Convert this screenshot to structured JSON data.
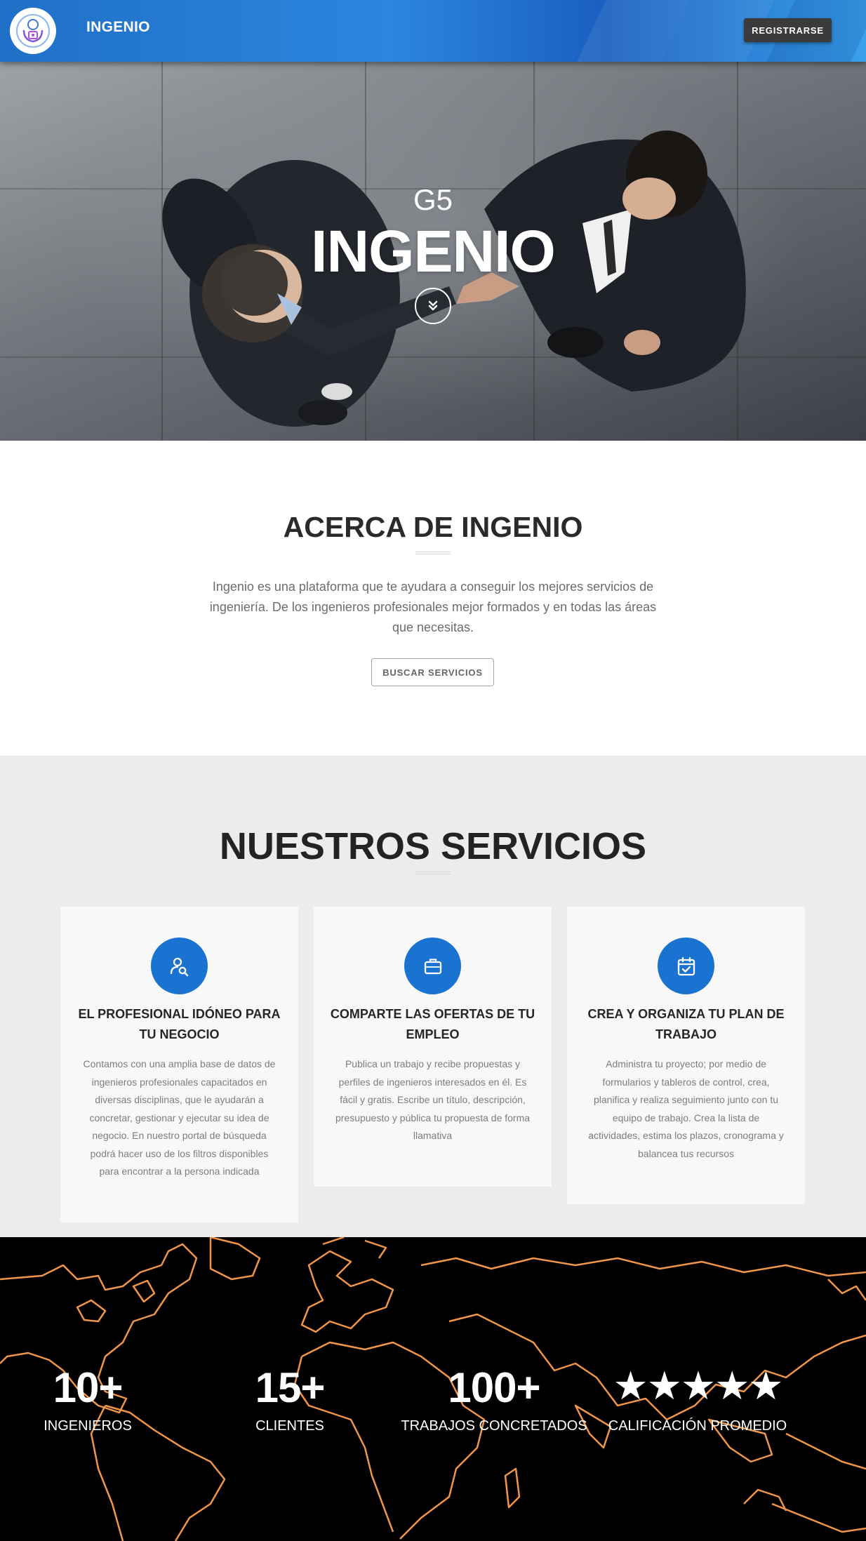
{
  "navbar": {
    "brand": "INGENIO",
    "logo_icon": "ingenio-logo-icon",
    "register_label": "REGISTRARSE"
  },
  "hero": {
    "subtitle": "G5",
    "title": "INGENIO",
    "scroll_icon": "chevron-double-down-icon"
  },
  "about": {
    "title": "ACERCA DE INGENIO",
    "text": "Ingenio es una plataforma que te ayudara a conseguir los mejores servicios de ingeniería. De los ingenieros profesionales mejor formados y en todas las áreas que necesitas.",
    "button_label": "BUSCAR SERVICIOS"
  },
  "services": {
    "title": "NUESTROS SERVICIOS",
    "cards": [
      {
        "icon": "user-search-icon",
        "title": "EL PROFESIONAL IDÓNEO PARA TU NEGOCIO",
        "text": "Contamos con una amplia base de datos de ingenieros profesionales capacitados en diversas disciplinas, que le ayudarán a concretar, gestionar y ejecutar su idea de negocio. En nuestro portal de búsqueda podrá hacer uso de los filtros disponibles para encontrar a la persona indicada"
      },
      {
        "icon": "briefcase-icon",
        "title": "COMPARTE LAS OFERTAS DE TU EMPLEO",
        "text": "Publica un trabajo y recibe propuestas y perfiles de ingenieros interesados en él. Es fácil y gratis. Escribe un título, descripción, presupuesto y pública tu propuesta de forma llamativa"
      },
      {
        "icon": "calendar-check-icon",
        "title": "CREA Y ORGANIZA TU PLAN DE TRABAJO",
        "text": "Administra tu proyecto; por medio de formularios y tableros de control, crea, planifica y realiza seguimiento junto con tu equipo de trabajo. Crea la lista de actividades, estima los plazos, cronograma y balancea tus recursos"
      }
    ]
  },
  "stats": {
    "items": [
      {
        "value": "10+",
        "label": "INGENIEROS"
      },
      {
        "value": "15+",
        "label": "CLIENTES"
      },
      {
        "value": "100+",
        "label": "TRABAJOS CONCRETADOS"
      },
      {
        "value": "★★★★★",
        "label": "CALIFICACIÓN PROMEDIO"
      }
    ],
    "rating": 5,
    "map_line_color": "#f0954a"
  },
  "colors": {
    "primary_blue": "#1a73d1",
    "navbar_blue": "#2b86df",
    "dark_button": "#3b3b3b"
  }
}
